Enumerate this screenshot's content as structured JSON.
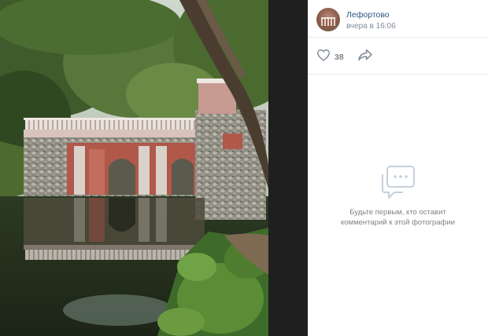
{
  "photo": {
    "alt_icon": "photo-park-grotto"
  },
  "post": {
    "group_name": "Лефортово",
    "time": "вчера в 16:06",
    "likes": "38",
    "like_icon": "heart-icon",
    "share_icon": "share-arrow-icon"
  },
  "comments": {
    "empty_icon": "comment-bubble-icon",
    "empty_text": "Будьте первым, кто оставит комментарий к этой фотографии"
  },
  "colors": {
    "link": "#2a5885",
    "muted": "#828282",
    "backdrop": "#1f1f1f"
  }
}
